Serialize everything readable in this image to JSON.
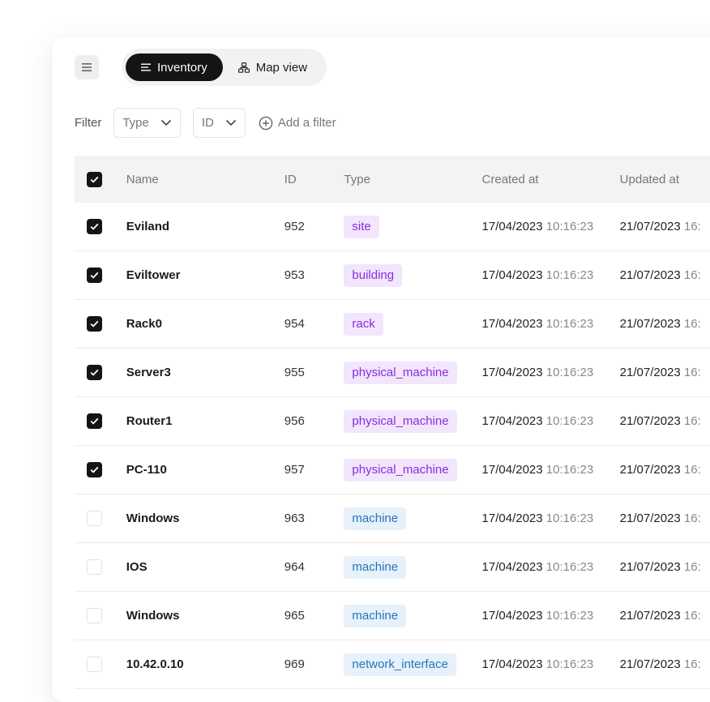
{
  "toolbar": {
    "menu_icon": "hamburger-icon",
    "views": [
      {
        "label": "Inventory",
        "icon": "list-icon",
        "active": true
      },
      {
        "label": "Map view",
        "icon": "hierarchy-icon",
        "active": false
      }
    ]
  },
  "filters": {
    "label": "Filter",
    "selects": [
      {
        "label": "Type"
      },
      {
        "label": "ID"
      }
    ],
    "add_label": "Add a filter"
  },
  "table": {
    "columns": [
      "Name",
      "ID",
      "Type",
      "Created at",
      "Updated at"
    ],
    "header_checked": true,
    "rows": [
      {
        "checked": true,
        "name": "Eviland",
        "id": "952",
        "type": "site",
        "type_color": "purple",
        "created_date": "17/04/2023",
        "created_time": "10:16:23",
        "updated_date": "21/07/2023",
        "updated_time": "16:"
      },
      {
        "checked": true,
        "name": "Eviltower",
        "id": "953",
        "type": "building",
        "type_color": "purple",
        "created_date": "17/04/2023",
        "created_time": "10:16:23",
        "updated_date": "21/07/2023",
        "updated_time": "16:"
      },
      {
        "checked": true,
        "name": "Rack0",
        "id": "954",
        "type": "rack",
        "type_color": "purple",
        "created_date": "17/04/2023",
        "created_time": "10:16:23",
        "updated_date": "21/07/2023",
        "updated_time": "16:"
      },
      {
        "checked": true,
        "name": "Server3",
        "id": "955",
        "type": "physical_machine",
        "type_color": "purple",
        "created_date": "17/04/2023",
        "created_time": "10:16:23",
        "updated_date": "21/07/2023",
        "updated_time": "16:"
      },
      {
        "checked": true,
        "name": "Router1",
        "id": "956",
        "type": "physical_machine",
        "type_color": "purple",
        "created_date": "17/04/2023",
        "created_time": "10:16:23",
        "updated_date": "21/07/2023",
        "updated_time": "16:"
      },
      {
        "checked": true,
        "name": "PC-110",
        "id": "957",
        "type": "physical_machine",
        "type_color": "purple",
        "created_date": "17/04/2023",
        "created_time": "10:16:23",
        "updated_date": "21/07/2023",
        "updated_time": "16:"
      },
      {
        "checked": false,
        "name": "Windows",
        "id": "963",
        "type": "machine",
        "type_color": "blue",
        "created_date": "17/04/2023",
        "created_time": "10:16:23",
        "updated_date": "21/07/2023",
        "updated_time": "16:"
      },
      {
        "checked": false,
        "name": "IOS",
        "id": "964",
        "type": "machine",
        "type_color": "blue",
        "created_date": "17/04/2023",
        "created_time": "10:16:23",
        "updated_date": "21/07/2023",
        "updated_time": "16:"
      },
      {
        "checked": false,
        "name": "Windows",
        "id": "965",
        "type": "machine",
        "type_color": "blue",
        "created_date": "17/04/2023",
        "created_time": "10:16:23",
        "updated_date": "21/07/2023",
        "updated_time": "16:"
      },
      {
        "checked": false,
        "name": "10.42.0.10",
        "id": "969",
        "type": "network_interface",
        "type_color": "blue",
        "created_date": "17/04/2023",
        "created_time": "10:16:23",
        "updated_date": "21/07/2023",
        "updated_time": "16:"
      }
    ]
  },
  "colors": {
    "active_toggle": "#141414",
    "purple_tag_bg": "#f1e6fb",
    "purple_tag_text": "#8a2be2",
    "blue_tag_bg": "#e6f1fb",
    "blue_tag_text": "#2a73b8"
  }
}
